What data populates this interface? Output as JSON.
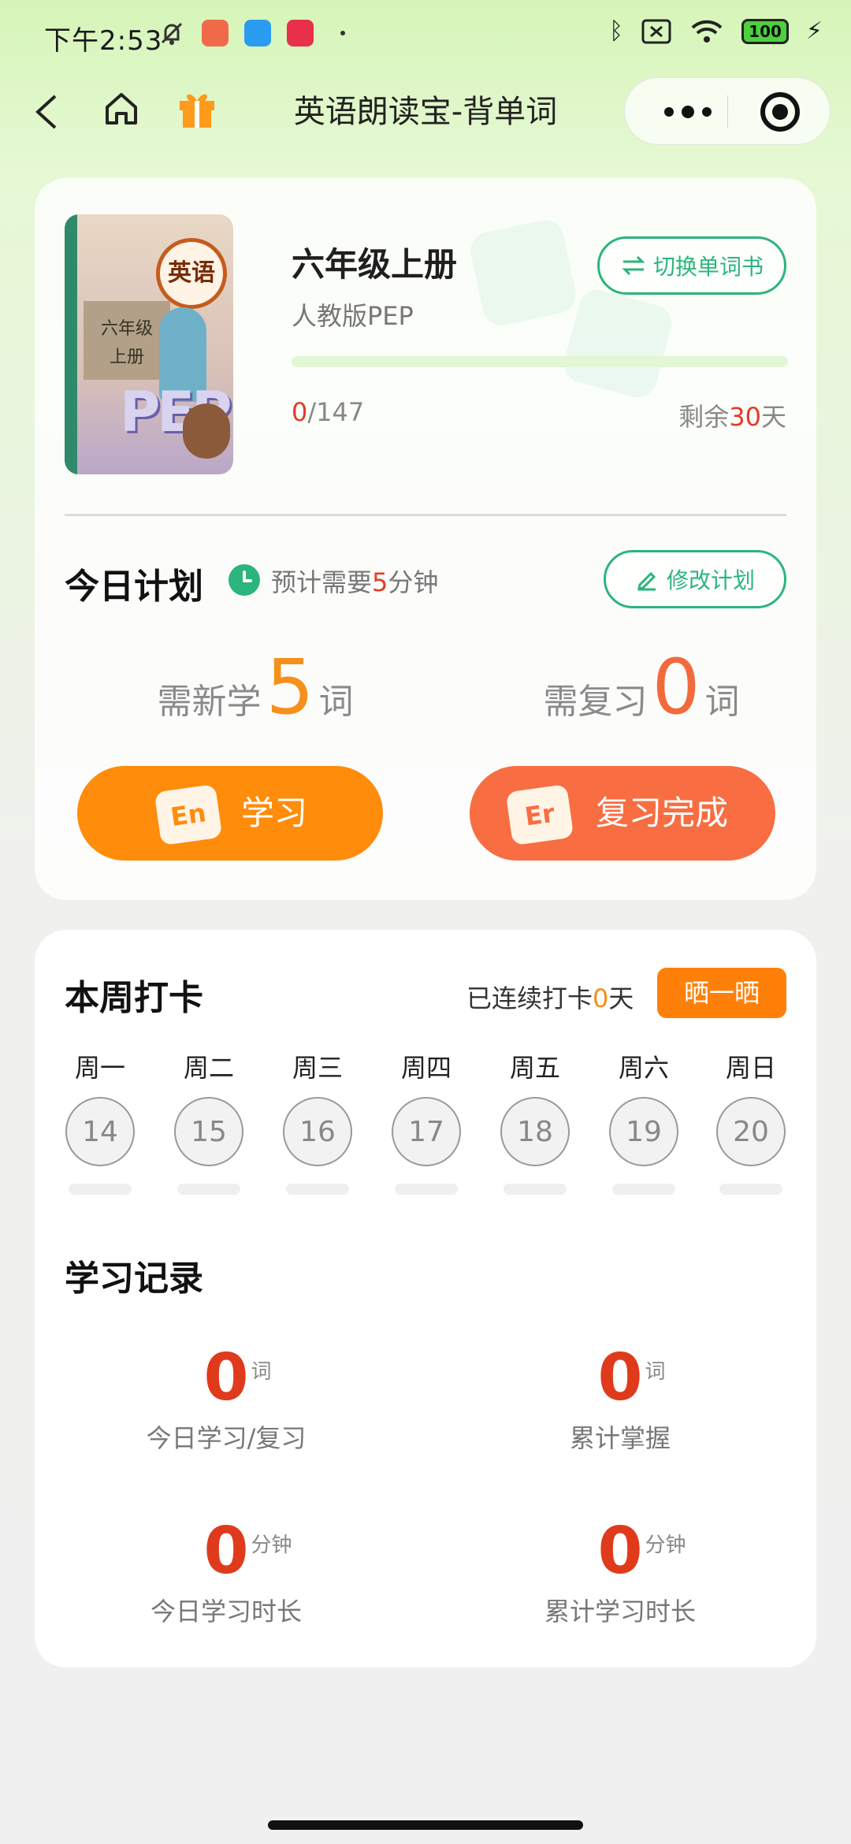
{
  "status_bar": {
    "time": "下午2:53",
    "battery": "100",
    "app_icon_colors": [
      "#f06a4a",
      "#2a9cf0",
      "#e8304a"
    ]
  },
  "nav": {
    "title": "英语朗读宝-背单词",
    "icons": [
      "back-icon",
      "home-icon",
      "gift-icon",
      "more-icon",
      "close-icon"
    ]
  },
  "book": {
    "cover_title": "英语",
    "cover_grade": "六年级",
    "cover_term": "上册",
    "cover_logo": "PEP",
    "title": "六年级上册",
    "edition": "人教版PEP",
    "switch_label": "切换单词书",
    "learned": "0",
    "total": "/147",
    "progress_fraction": 0,
    "days_prefix": "剩余",
    "days_left": "30",
    "days_suffix": "天"
  },
  "plan": {
    "title": "今日计划",
    "estimate_prefix": "预计需要",
    "estimate_minutes": "5",
    "estimate_suffix": "分钟",
    "edit_label": "修改计划",
    "new_prefix": "需新学",
    "new_count": "5",
    "new_suffix": "词",
    "review_prefix": "需复习",
    "review_count": "0",
    "review_suffix": "词",
    "study_badge": "En",
    "study_label": "学习",
    "review_badge": "Er",
    "review_label": "复习完成"
  },
  "week": {
    "title": "本周打卡",
    "streak_prefix": "已连续打卡",
    "streak_days": "0",
    "streak_suffix": "天",
    "share_label": "晒一晒",
    "days": [
      {
        "name": "周一",
        "date": "14"
      },
      {
        "name": "周二",
        "date": "15"
      },
      {
        "name": "周三",
        "date": "16"
      },
      {
        "name": "周四",
        "date": "17"
      },
      {
        "name": "周五",
        "date": "18"
      },
      {
        "name": "周六",
        "date": "19"
      },
      {
        "name": "周日",
        "date": "20"
      }
    ]
  },
  "records": {
    "title": "学习记录",
    "items": [
      {
        "value": "0",
        "unit": "词",
        "label": "今日学习/复习"
      },
      {
        "value": "0",
        "unit": "词",
        "label": "累计掌握"
      },
      {
        "value": "0",
        "unit": "分钟",
        "label": "今日学习时长"
      },
      {
        "value": "0",
        "unit": "分钟",
        "label": "累计学习时长"
      }
    ]
  },
  "colors": {
    "accent_green": "#2bb57c",
    "accent_orange": "#ff8c0a",
    "accent_coral": "#f86d41",
    "value_red": "#e03a1c"
  }
}
